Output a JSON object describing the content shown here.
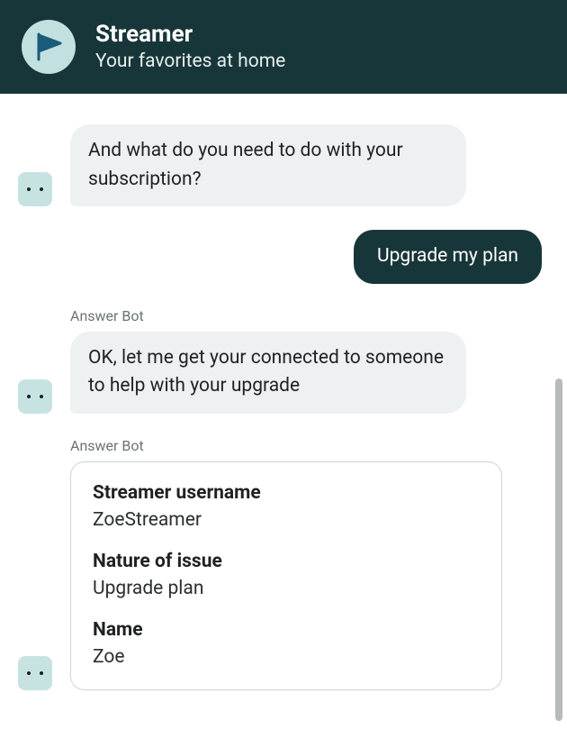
{
  "header": {
    "title": "Streamer",
    "subtitle": "Your favorites at home",
    "logo_color": "#c2e0e0",
    "logo_accent": "#1a5a7a"
  },
  "bot_name": "Answer Bot",
  "messages": {
    "bot1": "And what do you need to do with your subscription?",
    "user1": "Upgrade my plan",
    "bot2": "OK, let me get your connected to someone to help with your upgrade"
  },
  "summary_card": {
    "fields": [
      {
        "label": "Streamer username",
        "value": "ZoeStreamer"
      },
      {
        "label": "Nature of issue",
        "value": "Upgrade plan"
      },
      {
        "label": "Name",
        "value": "Zoe"
      }
    ]
  },
  "colors": {
    "header_bg": "#17363a",
    "bot_bubble": "#eef1f1",
    "user_bubble": "#17363a"
  }
}
